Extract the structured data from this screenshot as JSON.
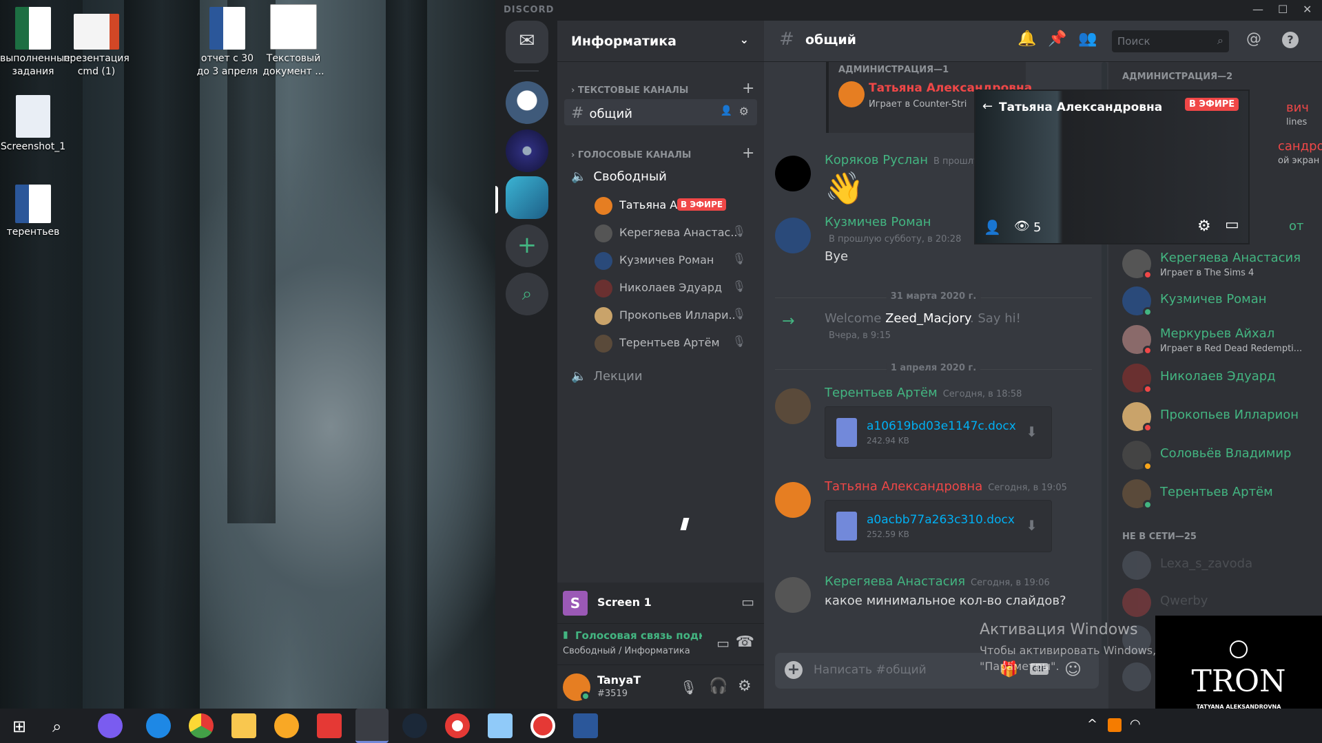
{
  "desktop": {
    "icons": [
      {
        "label": "выполненные задания"
      },
      {
        "label": "презентация cmd (1)"
      },
      {
        "label": "отчет с 30 до 3 апреля"
      },
      {
        "label": "Текстовый документ ..."
      },
      {
        "label": "Screenshot_1"
      },
      {
        "label": "терентьев"
      }
    ],
    "activation_title": "Активация Windows",
    "activation_text": "Чтобы активировать Windows, перейдите в раздел",
    "activation_text2": "\"Параметры\"."
  },
  "window": {
    "brand": "DISCORD"
  },
  "server": {
    "name": "Информатика",
    "text_category": "ТЕКСТОВЫЕ КАНАЛЫ",
    "text_channels": [
      {
        "name": "общий"
      }
    ],
    "voice_category": "ГОЛОСОВЫЕ КАНАЛЫ",
    "voice_channels": [
      {
        "name": "Свободный"
      },
      {
        "name": "Лекции"
      }
    ],
    "voice_users": [
      {
        "name": "Татьяна Ал...",
        "badge": "В ЭФИРЕ"
      },
      {
        "name": "Кeрегяева Анастас..."
      },
      {
        "name": "Кузмичев Роман"
      },
      {
        "name": "Николаев Эдуард"
      },
      {
        "name": "Прокопьев Иллари..."
      },
      {
        "name": "Терентьев Артём"
      }
    ]
  },
  "screen_panel": {
    "letter": "S",
    "label": "Screen 1"
  },
  "voice_panel": {
    "status": "Голосовая связь подкл",
    "location": "Свободный / Информатика"
  },
  "user_panel": {
    "name": "TanyaT",
    "tag": "#3519"
  },
  "chat": {
    "channel": "общий",
    "search_placeholder": "Поиск",
    "input_placeholder": "Написать #общий",
    "top_section": "АДМИНИСТРАЦИЯ—1",
    "top_user": "Татьяна Александровна",
    "top_activity": "Играет в Counter-Stri",
    "messages": [
      {
        "author": "Коряков Руслан",
        "time": "В прошлу",
        "body": "👋",
        "color": "#43b581"
      },
      {
        "author": "Кузмичев Роман",
        "time": "В прошлую субботу, в 20:28",
        "body": "Bye",
        "color": "#43b581"
      }
    ],
    "divider1": "31 марта 2020 г.",
    "welcome_prefix": "Welcome ",
    "welcome_user": "Zeed_Macjory",
    "welcome_suffix": ". Say hi!",
    "welcome_time": "Вчера, в 9:15",
    "divider2": "1 апреля 2020 г.",
    "msg3": {
      "author": "Терентьев Артём",
      "time": "Сегодня, в 18:58",
      "file": "a10619bd03e1147c.docx",
      "size": "242.94 KB"
    },
    "msg4": {
      "author": "Татьяна Александровна",
      "time": "Сегодня, в 19:05",
      "file": "a0acbb77a263c310.docx",
      "size": "252.59 KB"
    },
    "msg5": {
      "author": "Керегяева Анастасия",
      "time": "Сегодня, в 19:06",
      "body": "какое минимальное кол-во слайдов?"
    }
  },
  "stream": {
    "title": "Татьяна Александровна",
    "badge": "В ЭФИРЕ",
    "viewers": "5"
  },
  "members": {
    "section1": "АДМИНИСТРАЦИЯ—2",
    "partial1": "вич",
    "partial1b": "lines",
    "partial2": "сандро...",
    "partial2b": "ой экран",
    "partial3": "от",
    "list": [
      {
        "name": "Керегяева Анастасия",
        "status": "Играет в The Sims 4"
      },
      {
        "name": "Кузмичев Роман",
        "status": ""
      },
      {
        "name": "Меркурьев Айхал",
        "status": "Играет в Red Dead Redempti..."
      },
      {
        "name": "Николаев Эдуард",
        "status": ""
      },
      {
        "name": "Прокопьев Илларион",
        "status": ""
      },
      {
        "name": "Соловьёв Владимир",
        "status": ""
      },
      {
        "name": "Терентьев Артём",
        "status": ""
      }
    ],
    "offline_section": "НЕ В СЕТИ—25",
    "offline": [
      {
        "name": "Lexa_s_zavoda"
      },
      {
        "name": "Qwerby"
      }
    ]
  },
  "overlay": {
    "brand": "TRON",
    "subtitle": "TATYANA ALEKSANDROVNA"
  },
  "colors": {
    "accent": "#7289da",
    "online": "#43b581",
    "live": "#f04747",
    "link": "#00b0f4"
  }
}
